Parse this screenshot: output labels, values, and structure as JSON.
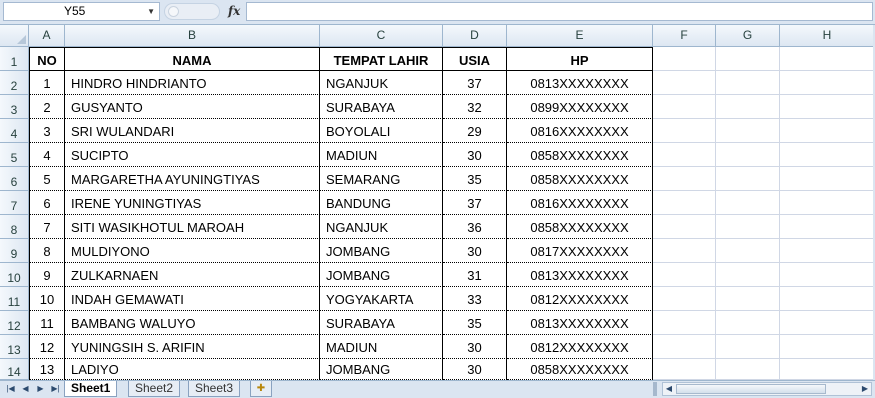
{
  "formula_bar": {
    "name_box": "Y55",
    "fx_label": "fx",
    "formula": ""
  },
  "columns": [
    "A",
    "B",
    "C",
    "D",
    "E",
    "F",
    "G",
    "H"
  ],
  "row_numbers": [
    "1",
    "2",
    "3",
    "4",
    "5",
    "6",
    "7",
    "8",
    "9",
    "10",
    "11",
    "12",
    "13",
    "14"
  ],
  "table": {
    "headers": [
      "NO",
      "NAMA",
      "TEMPAT LAHIR",
      "USIA",
      "HP"
    ],
    "rows": [
      [
        "1",
        "HINDRO HINDRIANTO",
        "NGANJUK",
        "37",
        "0813XXXXXXXX"
      ],
      [
        "2",
        "GUSYANTO",
        "SURABAYA",
        "32",
        "0899XXXXXXXX"
      ],
      [
        "3",
        "SRI WULANDARI",
        "BOYOLALI",
        "29",
        "0816XXXXXXXX"
      ],
      [
        "4",
        "SUCIPTO",
        "MADIUN",
        "30",
        "0858XXXXXXXX"
      ],
      [
        "5",
        "MARGARETHA  AYUNINGTIYAS",
        "SEMARANG",
        "35",
        "0858XXXXXXXX"
      ],
      [
        "6",
        "IRENE YUNINGTIYAS",
        "BANDUNG",
        "37",
        "0816XXXXXXXX"
      ],
      [
        "7",
        "SITI WASIKHOTUL MAROAH",
        "NGANJUK",
        "36",
        "0858XXXXXXXX"
      ],
      [
        "8",
        "MULDIYONO",
        "JOMBANG",
        "30",
        "0817XXXXXXXX"
      ],
      [
        "9",
        "ZULKARNAEN",
        "JOMBANG",
        "31",
        "0813XXXXXXXX"
      ],
      [
        "10",
        "INDAH GEMAWATI",
        "YOGYAKARTA",
        "33",
        "0812XXXXXXXX"
      ],
      [
        "11",
        "BAMBANG WALUYO",
        "SURABAYA",
        "35",
        "0813XXXXXXXX"
      ],
      [
        "12",
        "YUNINGSIH S. ARIFIN",
        "MADIUN",
        "30",
        "0812XXXXXXXX"
      ],
      [
        "13",
        "LADIYO",
        "JOMBANG",
        "30",
        "0858XXXXXXXX"
      ]
    ]
  },
  "sheet_tabs": [
    "Sheet1",
    "Sheet2",
    "Sheet3"
  ],
  "active_sheet": "Sheet1",
  "icons": {
    "insert_sheet": "insert-worksheet-icon",
    "nav": [
      "first-sheet-icon",
      "prev-sheet-icon",
      "next-sheet-icon",
      "last-sheet-icon"
    ]
  },
  "colors": {
    "header_bg": "#dbe5f1",
    "gridline": "#d0d7e5",
    "header_border": "#9eb6ce"
  }
}
